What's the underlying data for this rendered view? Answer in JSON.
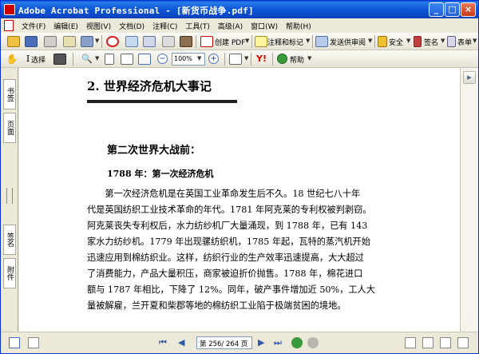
{
  "window": {
    "title": "Adobe Acrobat Professional - [新货币战争.pdf]"
  },
  "menu": {
    "items": [
      "文件(F)",
      "编辑(E)",
      "视图(V)",
      "文档(D)",
      "注释(C)",
      "工具(T)",
      "高级(A)",
      "窗口(W)",
      "帮助(H)"
    ]
  },
  "toolbar1": {
    "create_pdf": "创建 PDF",
    "comment_markup": "注释和标记",
    "send_review": "发送供审阅",
    "security": "安全",
    "sign": "签名",
    "forms": "表单"
  },
  "toolbar2": {
    "select_tool": "选择",
    "zoom_value": "100%",
    "help": "帮助"
  },
  "nav": {
    "tab1": "书签",
    "tab2": "页面",
    "tab3": "签名",
    "tab4": "附件"
  },
  "document": {
    "chapter_title": "2. 世界经济危机大事记",
    "section_title": "第二次世界大战前：",
    "sub_title": "1788 年：第一次经济危机",
    "paragraph_lines": [
      "　　第一次经济危机是在英国工业革命发生后不久。18 世纪七八十年",
      "代是英国纺织工业技术革命的年代。1781 年阿克莱的专利权被判剥窃。",
      "阿克莱丧失专利权后，水力纺纱机厂大量涌现，到 1788 年，已有 143",
      "家水力纺纱机。1779 年出现骡纺织机，1785 年起，瓦特的蒸汽机开始",
      "迅速应用到棉纺织业。这样，纺织行业的生产效率迅速提高，大大超过",
      "了消费能力，产品大量积压，商家被迫折价抛售。1788 年，棉花进口",
      "额与 1787 年相比，下降了 12%。同年，破产事件增加近 50%，工人大",
      "量被解雇，兰开夏和柴郡等地的棉纺织工业陷于极端贫困的境地。"
    ]
  },
  "statusbar": {
    "page_indicator": "第 256/ 264 页"
  },
  "colors": {
    "titlebar": "#0a46c4",
    "chrome": "#ece9d8"
  }
}
